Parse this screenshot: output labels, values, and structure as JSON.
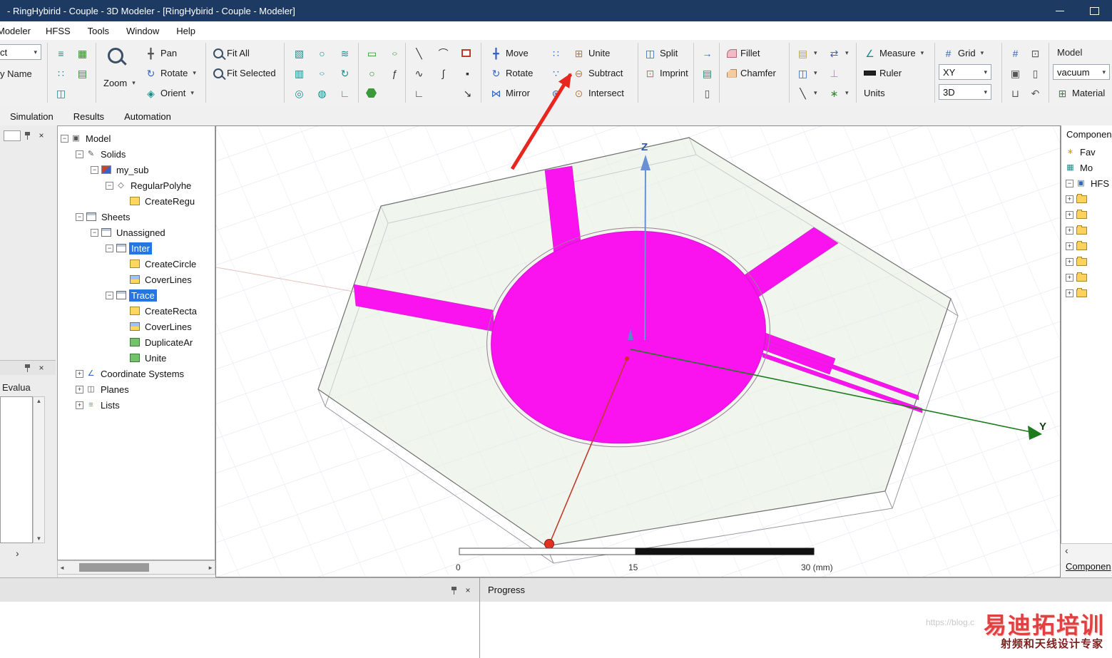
{
  "title_bar": {
    "title": "- RingHybirid - Couple - 3D Modeler - [RingHybirid - Couple - Modeler]"
  },
  "menu": {
    "items": [
      "Modeler",
      "HFSS",
      "Tools",
      "Window",
      "Help"
    ]
  },
  "tabs": [
    "Simulation",
    "Results",
    "Automation"
  ],
  "toolbar": {
    "select_value": "ct",
    "by_name": "y Name",
    "zoom": "Zoom",
    "pan": "Pan",
    "rotate_view": "Rotate",
    "orient": "Orient",
    "fit_all": "Fit All",
    "fit_selected": "Fit Selected",
    "move": "Move",
    "rotate_edit": "Rotate",
    "mirror": "Mirror",
    "unite": "Unite",
    "subtract": "Subtract",
    "intersect": "Intersect",
    "split": "Split",
    "imprint": "Imprint",
    "fillet": "Fillet",
    "chamfer": "Chamfer",
    "measure": "Measure",
    "ruler": "Ruler",
    "units": "Units",
    "grid": "Grid",
    "plane_value": "XY",
    "mode_value": "3D",
    "model": "Model",
    "material_value": "vacuum",
    "material": "Material"
  },
  "model_tree": {
    "items": [
      {
        "label": "Model"
      },
      {
        "label": "Solids"
      },
      {
        "label": "my_sub"
      },
      {
        "label": "RegularPolyhe"
      },
      {
        "label": "CreateRegu"
      },
      {
        "label": "Sheets"
      },
      {
        "label": "Unassigned"
      },
      {
        "label": "Inter"
      },
      {
        "label": "CreateCircle"
      },
      {
        "label": "CoverLines"
      },
      {
        "label": "Trace"
      },
      {
        "label": "CreateRecta"
      },
      {
        "label": "CoverLines"
      },
      {
        "label": "DuplicateAr"
      },
      {
        "label": "Unite"
      },
      {
        "label": "Coordinate Systems"
      },
      {
        "label": "Planes"
      },
      {
        "label": "Lists"
      }
    ]
  },
  "viewport": {
    "axis_z": "Z",
    "axis_y": "Y",
    "scale": {
      "t0": "0",
      "t15": "15",
      "t30": "30 (mm)"
    }
  },
  "component_panel": {
    "header": "Componen",
    "items": [
      {
        "label": "Fav"
      },
      {
        "label": "Mo"
      },
      {
        "label": "HFS"
      },
      {
        "label": ""
      },
      {
        "label": ""
      },
      {
        "label": ""
      },
      {
        "label": ""
      },
      {
        "label": ""
      },
      {
        "label": ""
      },
      {
        "label": ""
      }
    ],
    "bottom_tab": "Componen"
  },
  "left_dock": {
    "header": "Evalua"
  },
  "status": {
    "progress": "Progress"
  },
  "watermark": {
    "title": "易迪拓培训",
    "subtitle": "射频和天线设计专家",
    "url": "https://blog.c"
  },
  "colors": {
    "accent_magenta": "#f816ee",
    "substrate": "#e7efe3",
    "axis_z": "#6b8fd4",
    "axis_y": "#1d7a1d",
    "axis_x": "#c23a2a",
    "annotation_arrow": "#e8261f",
    "selection_blue": "#2476e4",
    "titlebar_blue": "#1d3a63"
  },
  "icons": {
    "caret": "▾",
    "close": "×",
    "minus": "−",
    "plus": "+",
    "scroll_left": "◄",
    "scroll_right": "►",
    "scroll_up": "▲",
    "scroll_down": "▼",
    "chevron_left": "‹",
    "chevron_right": "›",
    "pan": "╋",
    "rotate": "↻",
    "orient": "◈",
    "box": "▧",
    "sphere": "○",
    "helix": "≋",
    "cylinder": "▥",
    "ellipsoid": "○",
    "spiral": "↻",
    "torus": "◎",
    "disc": "◍",
    "poly3d": "∟",
    "rect": "▭",
    "ellipse": "○",
    "circle": "○",
    "function": "ƒ",
    "line": "╲",
    "arc": "⌒",
    "spline": "∿",
    "fnline": "∫",
    "polyline": "∟",
    "dot": "▪",
    "sweep": "↘",
    "move": "╋",
    "mirror": "⋈",
    "array1": "∷",
    "array2": "∵",
    "array3": "⊛",
    "unite": "⊞",
    "subtract": "⊖",
    "intersect": "⊙",
    "split": "◫",
    "imprint": "⊡",
    "goto": "→",
    "sheetlist": "▤",
    "page": "▯",
    "measure": "∠",
    "grid": "#",
    "dd_folder": "▤",
    "dd_bool": "◫",
    "dd_line": "╲",
    "dd_arrows": "⇄",
    "dd_axis": "⊥",
    "dd_star": "∗",
    "tool1": "#",
    "tool2": "⊡",
    "tool3": "▣",
    "tool4": "▯",
    "tool5": "⊔",
    "tool6": "↶",
    "material": "⊞",
    "edit1": "≡",
    "edit2": "▦",
    "edit3": "∷",
    "edit4": "▤",
    "edit5": "◫",
    "model_node": "▣",
    "solids_node": "✎",
    "poly_node": "◇",
    "cs_node": "∠",
    "planes_node": "◫",
    "lists_node": "≡",
    "fav": "∗",
    "models": "▦",
    "hfss": "▣"
  }
}
